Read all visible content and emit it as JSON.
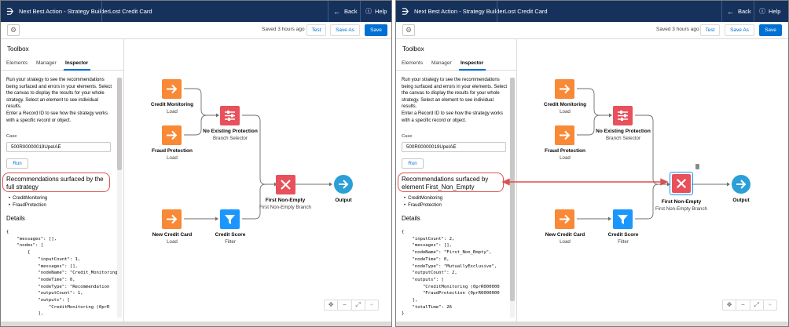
{
  "header": {
    "app_title": "Next Best Action - Strategy Builder",
    "tab": "Lost Credit Card",
    "back_label": "Back",
    "help_label": "Help"
  },
  "toolbar": {
    "saved": "Saved 3 hours ago",
    "test_label": "Test",
    "save_as_label": "Save As",
    "save_label": "Save"
  },
  "toolbox": {
    "title": "Toolbox",
    "tabs": [
      "Elements",
      "Manager",
      "Inspector"
    ],
    "active_tab": "Inspector",
    "intro": "Run your strategy to see the recommendations being surfaced and errors in your elements. Select the canvas to display the results for your whole strategy. Select an element to see individual results.",
    "intro2": "Enter a Record ID to see how the strategy works with a specific record or object.",
    "case_label": "Case",
    "case_value": "500R00000019UpeIAE",
    "run_label": "Run",
    "details_title": "Details"
  },
  "left": {
    "rec_title": "Recommendations surfaced by the full strategy",
    "recommendations": [
      "CreditMonitoring",
      "FraudProtection"
    ],
    "json_lines": [
      "{",
      "    \"messages\": [],",
      "    \"nodes\": [",
      "        {",
      "            \"inputCount\": 1,",
      "            \"messages\": [],",
      "            \"nodeName\": \"Credit_Monitoring",
      "            \"nodeTime\": 0,",
      "            \"nodeType\": \"Recommendation",
      "            \"outputCount\": 1,",
      "            \"outputs\": [",
      "                \"CreditMonitoring (0prR",
      "            ],"
    ]
  },
  "right": {
    "rec_title": "Recommendations surfaced by element First_Non_Empty",
    "recommendations": [
      "CreditMonitoring",
      "FraudProtection"
    ],
    "json_lines": [
      "{",
      "    \"inputCount\": 2,",
      "    \"messages\": [],",
      "    \"nodeName\": \"First_Non_Empty\",",
      "    \"nodeTime\": 0,",
      "    \"nodeType\": \"MutuallyExclusive\",",
      "    \"outputCount\": 2,",
      "    \"outputs\": [",
      "        \"CreditMonitoring (0prR000000",
      "        \"FraudProtection (0prR0000000",
      "    ],",
      "    \"totalTime\": 26",
      "}"
    ]
  },
  "nodes": {
    "credit_monitoring": {
      "label": "Credit Monitoring",
      "sub": "Load"
    },
    "fraud_protection": {
      "label": "Fraud Protection",
      "sub": "Load"
    },
    "new_credit_card": {
      "label": "New Credit Card",
      "sub": "Load"
    },
    "no_existing_protection": {
      "label": "No Existing Protection",
      "sub": "Branch Selector"
    },
    "credit_score": {
      "label": "Credit Score",
      "sub": "Filter"
    },
    "first_non_empty": {
      "label": "First Non-Empty",
      "sub": "First Non-Empty Branch"
    },
    "output": {
      "label": "Output"
    }
  },
  "colors": {
    "header": "#16325c",
    "load": "#f88937",
    "branch": "#e8505b",
    "filter": "#1b96ff",
    "output": "#2a9fd8",
    "highlight": "#d9534f"
  },
  "icons": {
    "load": "arrow-right-icon",
    "branch": "sliders-icon",
    "filter": "funnel-icon",
    "first_non_empty": "x-icon",
    "output": "arrow-right-circle-icon"
  }
}
